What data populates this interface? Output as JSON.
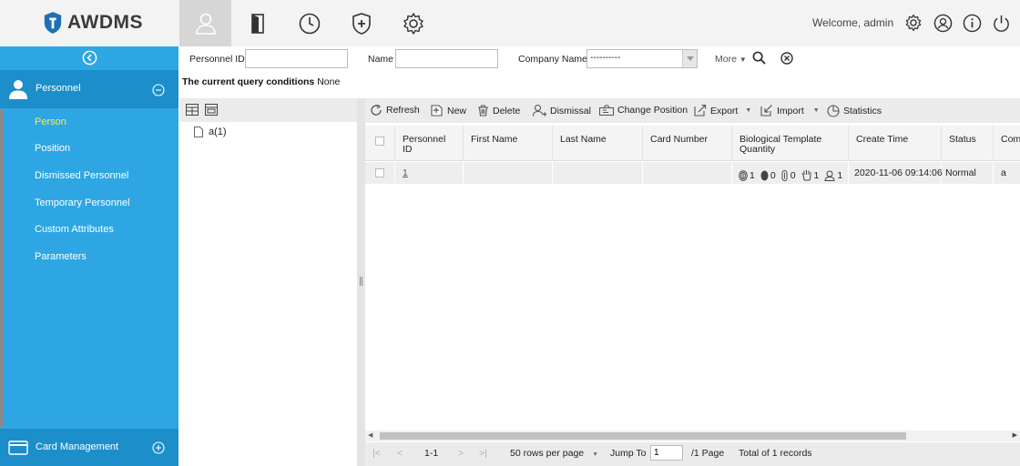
{
  "app": {
    "logo_text": "AWDMS",
    "welcome": "Welcome, admin"
  },
  "modules": [
    {
      "name": "personnel",
      "icon": "person-icon",
      "active": true
    },
    {
      "name": "device",
      "icon": "door-icon",
      "active": false
    },
    {
      "name": "attendance",
      "icon": "clock-icon",
      "active": false
    },
    {
      "name": "access",
      "icon": "shield-plus-icon",
      "active": false
    },
    {
      "name": "system",
      "icon": "gear-icon",
      "active": false
    }
  ],
  "sidebar": {
    "personnel_title": "Personnel",
    "items": [
      {
        "label": "Person",
        "active": true
      },
      {
        "label": "Position",
        "active": false
      },
      {
        "label": "Dismissed Personnel",
        "active": false
      },
      {
        "label": "Temporary Personnel",
        "active": false
      },
      {
        "label": "Custom Attributes",
        "active": false
      },
      {
        "label": "Parameters",
        "active": false
      }
    ],
    "card_title": "Card Management"
  },
  "filter": {
    "personnel_id_label": "Personnel ID",
    "personnel_id_value": "",
    "name_label": "Name",
    "name_value": "",
    "company_label": "Company Name",
    "company_value": "----------",
    "more_label": "More",
    "query_conditions": "The current query conditions",
    "query_value": "None"
  },
  "tree": {
    "node": "a(1)"
  },
  "toolbar": {
    "refresh": "Refresh",
    "new": "New",
    "delete": "Delete",
    "dismissal": "Dismissal",
    "change_position": "Change Position",
    "export": "Export",
    "import": "Import",
    "statistics": "Statistics"
  },
  "grid": {
    "columns": [
      "Personnel ID",
      "First Name",
      "Last Name",
      "Card Number",
      "Biological Template Quantity",
      "Create Time",
      "Status",
      "Com"
    ],
    "rows": [
      {
        "personnel_id": "1",
        "first_name": "",
        "last_name": "",
        "card_number": "",
        "bio": {
          "fingerprint": "1",
          "face": "0",
          "finger_vein": "0",
          "palm": "1",
          "visible_face": "1"
        },
        "create_time": "2020-11-06 09:14:06",
        "status": "Normal",
        "company": "a"
      }
    ]
  },
  "pager": {
    "range": "1-1",
    "rows_per_page": "50 rows per page",
    "jump_label": "Jump To",
    "jump_value": "1",
    "pages": "/1 Page",
    "total": "Total of 1 records"
  },
  "colors": {
    "sidebar_bg": "#2ea6e4",
    "sidebar_head": "#1c8fcb",
    "active_item": "#ffe94a",
    "logo_blue": "#1e6fb5"
  }
}
